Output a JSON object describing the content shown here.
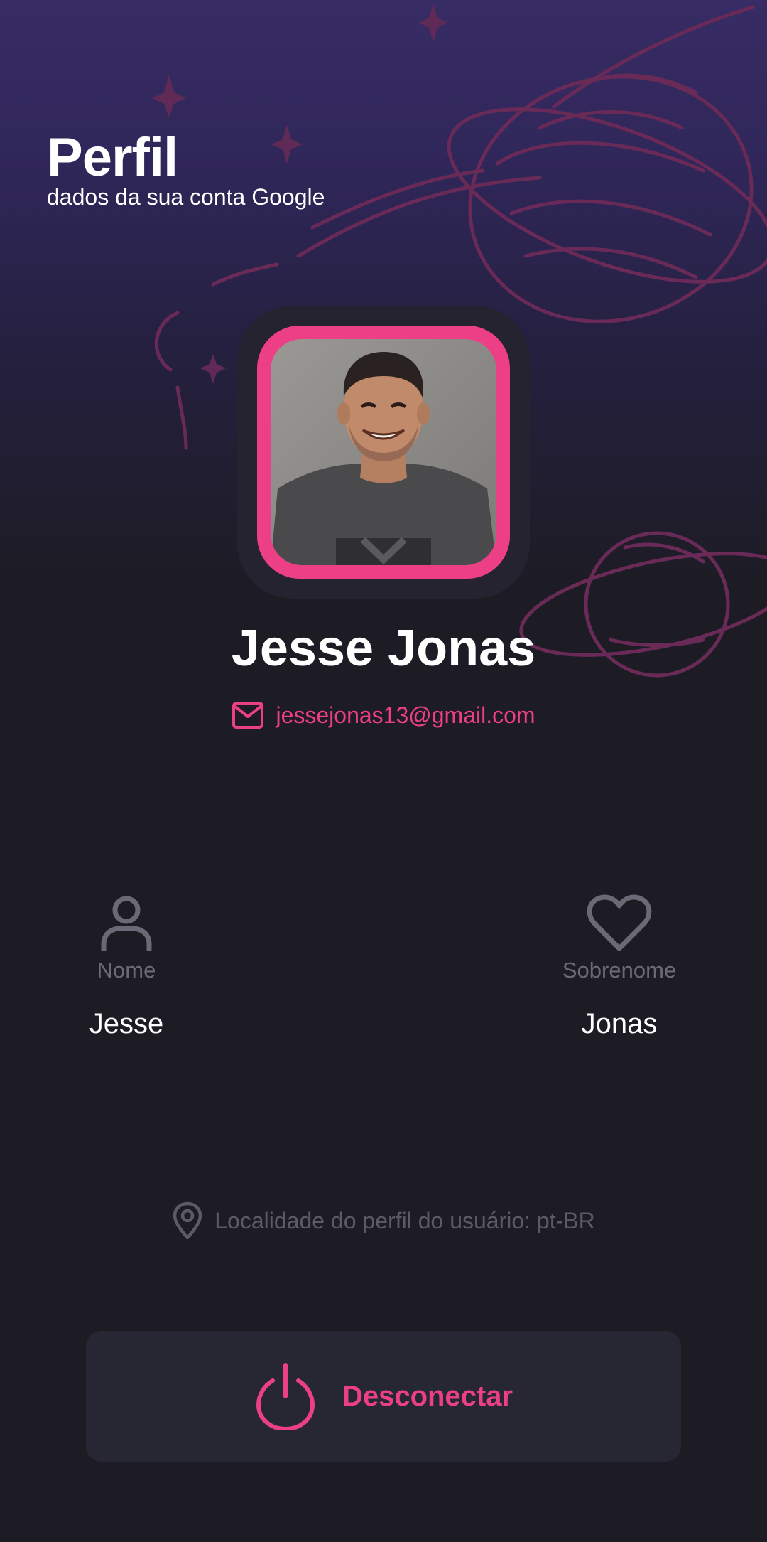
{
  "header": {
    "title": "Perfil",
    "subtitle": "dados da sua conta Google"
  },
  "profile": {
    "full_name": "Jesse Jonas",
    "email": "jessejonas13@gmail.com",
    "avatar_description": "profile-photo"
  },
  "fields": {
    "first_name": {
      "label": "Nome",
      "value": "Jesse",
      "icon": "user-icon"
    },
    "last_name": {
      "label": "Sobrenome",
      "value": "Jonas",
      "icon": "heart-icon"
    }
  },
  "locale": {
    "text": "Localidade do perfil do usuário: pt-BR",
    "icon": "location-pin-icon"
  },
  "logout": {
    "label": "Desconectar",
    "icon": "power-icon"
  },
  "colors": {
    "accent": "#ec3f86",
    "background": "#1d1c24",
    "header_gradient_top": "#372c64",
    "card": "#262733",
    "muted_text": "#6a6975"
  }
}
